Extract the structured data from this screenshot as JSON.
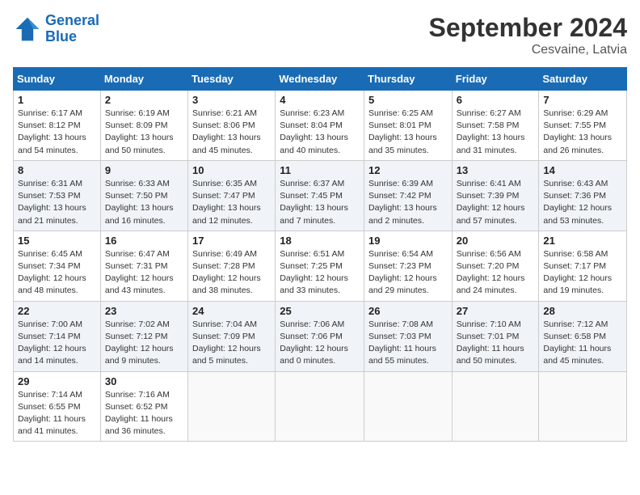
{
  "header": {
    "logo_line1": "General",
    "logo_line2": "Blue",
    "month_title": "September 2024",
    "location": "Cesvaine, Latvia"
  },
  "weekdays": [
    "Sunday",
    "Monday",
    "Tuesday",
    "Wednesday",
    "Thursday",
    "Friday",
    "Saturday"
  ],
  "weeks": [
    [
      {
        "day": "1",
        "sunrise": "Sunrise: 6:17 AM",
        "sunset": "Sunset: 8:12 PM",
        "daylight": "Daylight: 13 hours and 54 minutes."
      },
      {
        "day": "2",
        "sunrise": "Sunrise: 6:19 AM",
        "sunset": "Sunset: 8:09 PM",
        "daylight": "Daylight: 13 hours and 50 minutes."
      },
      {
        "day": "3",
        "sunrise": "Sunrise: 6:21 AM",
        "sunset": "Sunset: 8:06 PM",
        "daylight": "Daylight: 13 hours and 45 minutes."
      },
      {
        "day": "4",
        "sunrise": "Sunrise: 6:23 AM",
        "sunset": "Sunset: 8:04 PM",
        "daylight": "Daylight: 13 hours and 40 minutes."
      },
      {
        "day": "5",
        "sunrise": "Sunrise: 6:25 AM",
        "sunset": "Sunset: 8:01 PM",
        "daylight": "Daylight: 13 hours and 35 minutes."
      },
      {
        "day": "6",
        "sunrise": "Sunrise: 6:27 AM",
        "sunset": "Sunset: 7:58 PM",
        "daylight": "Daylight: 13 hours and 31 minutes."
      },
      {
        "day": "7",
        "sunrise": "Sunrise: 6:29 AM",
        "sunset": "Sunset: 7:55 PM",
        "daylight": "Daylight: 13 hours and 26 minutes."
      }
    ],
    [
      {
        "day": "8",
        "sunrise": "Sunrise: 6:31 AM",
        "sunset": "Sunset: 7:53 PM",
        "daylight": "Daylight: 13 hours and 21 minutes."
      },
      {
        "day": "9",
        "sunrise": "Sunrise: 6:33 AM",
        "sunset": "Sunset: 7:50 PM",
        "daylight": "Daylight: 13 hours and 16 minutes."
      },
      {
        "day": "10",
        "sunrise": "Sunrise: 6:35 AM",
        "sunset": "Sunset: 7:47 PM",
        "daylight": "Daylight: 13 hours and 12 minutes."
      },
      {
        "day": "11",
        "sunrise": "Sunrise: 6:37 AM",
        "sunset": "Sunset: 7:45 PM",
        "daylight": "Daylight: 13 hours and 7 minutes."
      },
      {
        "day": "12",
        "sunrise": "Sunrise: 6:39 AM",
        "sunset": "Sunset: 7:42 PM",
        "daylight": "Daylight: 13 hours and 2 minutes."
      },
      {
        "day": "13",
        "sunrise": "Sunrise: 6:41 AM",
        "sunset": "Sunset: 7:39 PM",
        "daylight": "Daylight: 12 hours and 57 minutes."
      },
      {
        "day": "14",
        "sunrise": "Sunrise: 6:43 AM",
        "sunset": "Sunset: 7:36 PM",
        "daylight": "Daylight: 12 hours and 53 minutes."
      }
    ],
    [
      {
        "day": "15",
        "sunrise": "Sunrise: 6:45 AM",
        "sunset": "Sunset: 7:34 PM",
        "daylight": "Daylight: 12 hours and 48 minutes."
      },
      {
        "day": "16",
        "sunrise": "Sunrise: 6:47 AM",
        "sunset": "Sunset: 7:31 PM",
        "daylight": "Daylight: 12 hours and 43 minutes."
      },
      {
        "day": "17",
        "sunrise": "Sunrise: 6:49 AM",
        "sunset": "Sunset: 7:28 PM",
        "daylight": "Daylight: 12 hours and 38 minutes."
      },
      {
        "day": "18",
        "sunrise": "Sunrise: 6:51 AM",
        "sunset": "Sunset: 7:25 PM",
        "daylight": "Daylight: 12 hours and 33 minutes."
      },
      {
        "day": "19",
        "sunrise": "Sunrise: 6:54 AM",
        "sunset": "Sunset: 7:23 PM",
        "daylight": "Daylight: 12 hours and 29 minutes."
      },
      {
        "day": "20",
        "sunrise": "Sunrise: 6:56 AM",
        "sunset": "Sunset: 7:20 PM",
        "daylight": "Daylight: 12 hours and 24 minutes."
      },
      {
        "day": "21",
        "sunrise": "Sunrise: 6:58 AM",
        "sunset": "Sunset: 7:17 PM",
        "daylight": "Daylight: 12 hours and 19 minutes."
      }
    ],
    [
      {
        "day": "22",
        "sunrise": "Sunrise: 7:00 AM",
        "sunset": "Sunset: 7:14 PM",
        "daylight": "Daylight: 12 hours and 14 minutes."
      },
      {
        "day": "23",
        "sunrise": "Sunrise: 7:02 AM",
        "sunset": "Sunset: 7:12 PM",
        "daylight": "Daylight: 12 hours and 9 minutes."
      },
      {
        "day": "24",
        "sunrise": "Sunrise: 7:04 AM",
        "sunset": "Sunset: 7:09 PM",
        "daylight": "Daylight: 12 hours and 5 minutes."
      },
      {
        "day": "25",
        "sunrise": "Sunrise: 7:06 AM",
        "sunset": "Sunset: 7:06 PM",
        "daylight": "Daylight: 12 hours and 0 minutes."
      },
      {
        "day": "26",
        "sunrise": "Sunrise: 7:08 AM",
        "sunset": "Sunset: 7:03 PM",
        "daylight": "Daylight: 11 hours and 55 minutes."
      },
      {
        "day": "27",
        "sunrise": "Sunrise: 7:10 AM",
        "sunset": "Sunset: 7:01 PM",
        "daylight": "Daylight: 11 hours and 50 minutes."
      },
      {
        "day": "28",
        "sunrise": "Sunrise: 7:12 AM",
        "sunset": "Sunset: 6:58 PM",
        "daylight": "Daylight: 11 hours and 45 minutes."
      }
    ],
    [
      {
        "day": "29",
        "sunrise": "Sunrise: 7:14 AM",
        "sunset": "Sunset: 6:55 PM",
        "daylight": "Daylight: 11 hours and 41 minutes."
      },
      {
        "day": "30",
        "sunrise": "Sunrise: 7:16 AM",
        "sunset": "Sunset: 6:52 PM",
        "daylight": "Daylight: 11 hours and 36 minutes."
      },
      null,
      null,
      null,
      null,
      null
    ]
  ]
}
